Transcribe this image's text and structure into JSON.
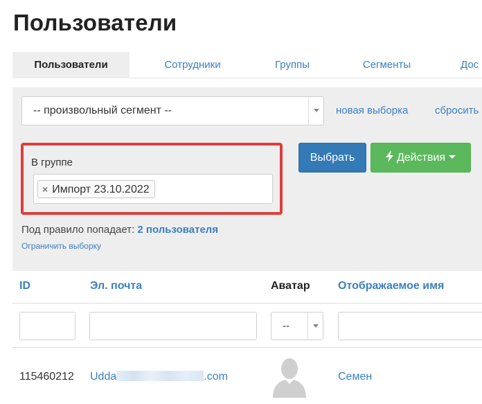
{
  "page": {
    "title": "Пользователи"
  },
  "tabs": [
    {
      "label": "Пользователи",
      "active": true
    },
    {
      "label": "Сотрудники"
    },
    {
      "label": "Группы"
    },
    {
      "label": "Сегменты"
    },
    {
      "label": "Дос"
    }
  ],
  "filter": {
    "segment_select_value": "-- произвольный сегмент --",
    "new_selection_link": "новая выборка",
    "reset_link": "сбросить",
    "group_label": "В группе",
    "group_tags": [
      {
        "label": "Импорт 23.10.2022",
        "remove_icon": "×"
      }
    ],
    "choose_button": "Выбрать",
    "actions_button": "Действия",
    "rule_count_prefix": "Под правило попадает:",
    "rule_count_value": "2 пользователя",
    "limit_link": "Ограничить выборку"
  },
  "table": {
    "headers": {
      "id": "ID",
      "email": "Эл. почта",
      "avatar": "Аватар",
      "display_name": "Отображаемое имя"
    },
    "avatar_filter_value": "--",
    "rows": [
      {
        "id": "115460212",
        "email_prefix": "Udda",
        "email_suffix": ".com",
        "display_name": "Семен"
      }
    ]
  },
  "colors": {
    "link": "#3a7fc2",
    "primary": "#337ab7",
    "success": "#5cb85c",
    "highlight": "#e03c3c",
    "panel": "#eeeeee"
  },
  "icons": {
    "actions": "lightning-icon",
    "tag_remove": "close-icon",
    "avatar": "user-silhouette-icon"
  }
}
